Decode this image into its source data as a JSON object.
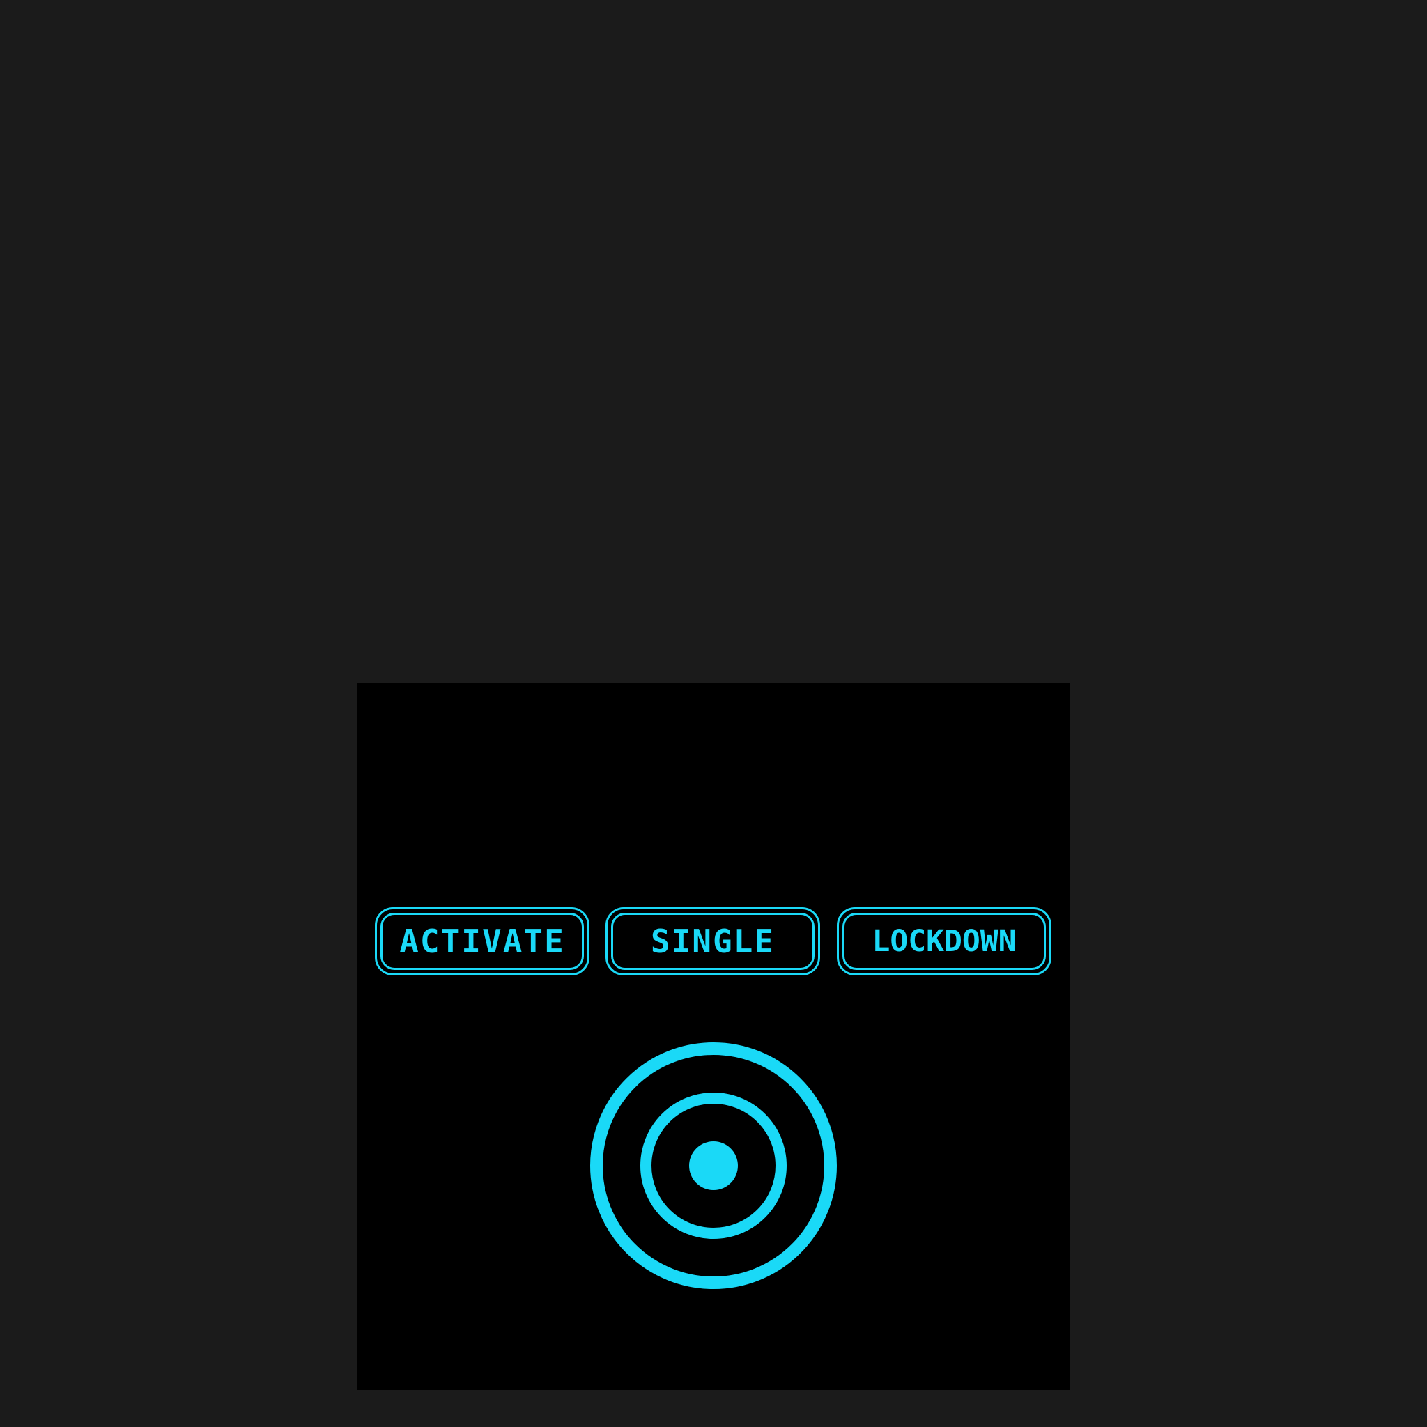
{
  "theme": {
    "accent": "#1ad9f7",
    "panel_bg": "#000000",
    "page_bg": "#1b1b1b"
  },
  "modes": {
    "activate_label": "ACTIVATE",
    "single_label": "SINGLE",
    "lockdown_label": "LOCKDOWN"
  },
  "target": {
    "icon": "target-icon"
  }
}
